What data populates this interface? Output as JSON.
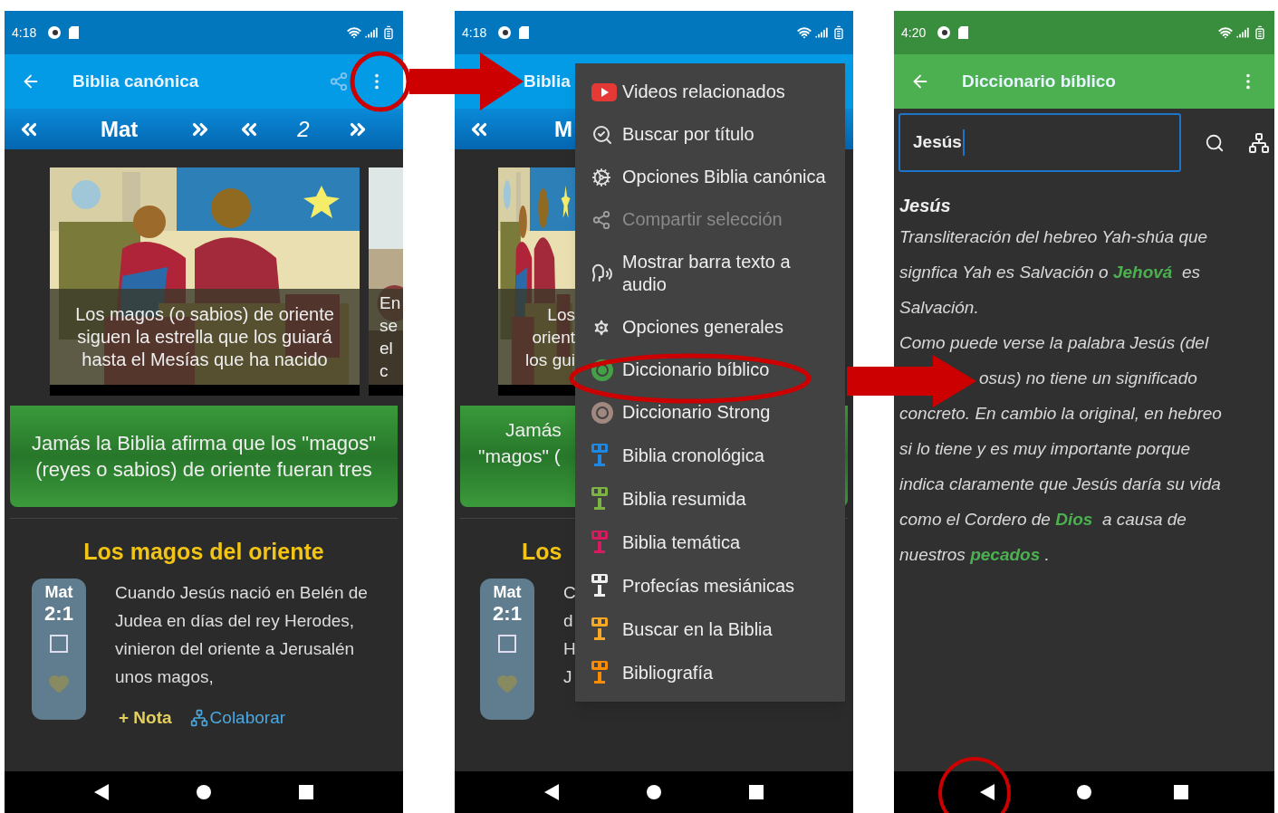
{
  "phones": [
    {
      "kind": "reader",
      "status": {
        "time": "4:18"
      },
      "app_bar": {
        "title": "Biblia canónica"
      },
      "nav": {
        "book": "Mat",
        "chapter": "2"
      },
      "slides": [
        {
          "caption": "Los magos (o sabios) de oriente siguen la estrella que los guiará hasta el Mesías que ha nacido"
        },
        {
          "caption_lines": [
            "En",
            "se",
            "el",
            "c"
          ]
        }
      ],
      "banner": "Jamás la Biblia afirma que los \"magos\" (reyes o sabios) de oriente fueran tres",
      "section_title": "Los magos del oriente",
      "verse": {
        "book": "Mat",
        "ref": "2:1",
        "checked": false,
        "text": "Cuando Jesús nació en Belén de Judea en días del rey Herodes, vinieron del oriente a Jerusalén unos magos,",
        "note": "+ Nota",
        "collaborate": "Colaborar"
      }
    },
    {
      "kind": "reader-menu",
      "status": {
        "time": "4:18"
      },
      "app_bar": {
        "title": "Biblia"
      },
      "nav": {
        "book": "M"
      },
      "slides": [
        {
          "caption_lines": [
            "Los",
            "orient",
            "los gui"
          ]
        }
      ],
      "banner_lines": [
        "Jamás",
        "\"magos\" ("
      ],
      "section_title": "Los",
      "verse": {
        "book": "Mat",
        "ref": "2:1",
        "checked": false,
        "text_lines": [
          "C",
          "d",
          "H",
          "J"
        ]
      },
      "menu": [
        {
          "label": "Videos relacionados",
          "color": "#e53935",
          "disabled": false
        },
        {
          "label": "Buscar por título",
          "color": "#e0e0e0",
          "disabled": false
        },
        {
          "label": "Opciones Biblia canónica",
          "color": "#e0e0e0",
          "disabled": false
        },
        {
          "label": "Compartir selección",
          "color": "#9e9e9e",
          "disabled": true
        },
        {
          "label": "Mostrar barra texto a audio",
          "color": "#e0e0e0",
          "disabled": false
        },
        {
          "label": "Opciones generales",
          "color": "#e0e0e0",
          "disabled": false
        },
        {
          "label": "Diccionario bíblico",
          "color": "#43a047",
          "disabled": false
        },
        {
          "label": "Diccionario Strong",
          "color": "#a1887f",
          "disabled": false
        },
        {
          "label": "Biblia cronológica",
          "color": "#1e88e5",
          "disabled": false
        },
        {
          "label": "Biblia resumida",
          "color": "#7cb342",
          "disabled": false
        },
        {
          "label": "Biblia temática",
          "color": "#d81b60",
          "disabled": false
        },
        {
          "label": "Profecías mesiánicas",
          "color": "#eeeeee",
          "disabled": false
        },
        {
          "label": "Buscar en la Biblia",
          "color": "#f9a825",
          "disabled": false
        },
        {
          "label": "Bibliografía",
          "color": "#fb8c00",
          "disabled": false
        }
      ]
    },
    {
      "kind": "dictionary",
      "status": {
        "time": "4:20"
      },
      "app_bar": {
        "title": "Diccionario bíblico"
      },
      "search": {
        "value": "Jesús"
      },
      "entry_title": "Jesús",
      "lines": [
        [
          {
            "text": "Transliteración del hebreo Yah-shúa que",
            "kind": "text"
          }
        ],
        [
          {
            "text": "signfica Yah es Salvación o ",
            "kind": "text"
          },
          {
            "text": "Jehová",
            "kind": "link"
          },
          {
            "text": "  es",
            "kind": "text"
          }
        ],
        [
          {
            "text": "Salvación.",
            "kind": "text"
          }
        ],
        [
          {
            "text": "Como puede verse la palabra Jesús (del",
            "kind": "text"
          }
        ],
        [
          {
            "text": "osus) no tiene un significado",
            "kind": "text"
          }
        ],
        [
          {
            "text": "concreto. En cambio la original, en hebreo",
            "kind": "text"
          }
        ],
        [
          {
            "text": "si lo tiene y es muy importante porque",
            "kind": "text"
          }
        ],
        [
          {
            "text": "indica claramente que Jesús daría su vida",
            "kind": "text"
          }
        ],
        [
          {
            "text": "como el Cordero de ",
            "kind": "text"
          },
          {
            "text": "Dios",
            "kind": "link"
          },
          {
            "text": "  a causa de",
            "kind": "text"
          }
        ],
        [
          {
            "text": "nuestros ",
            "kind": "text"
          },
          {
            "text": "pecados",
            "kind": "link"
          },
          {
            "text": " .",
            "kind": "text"
          }
        ]
      ]
    }
  ]
}
